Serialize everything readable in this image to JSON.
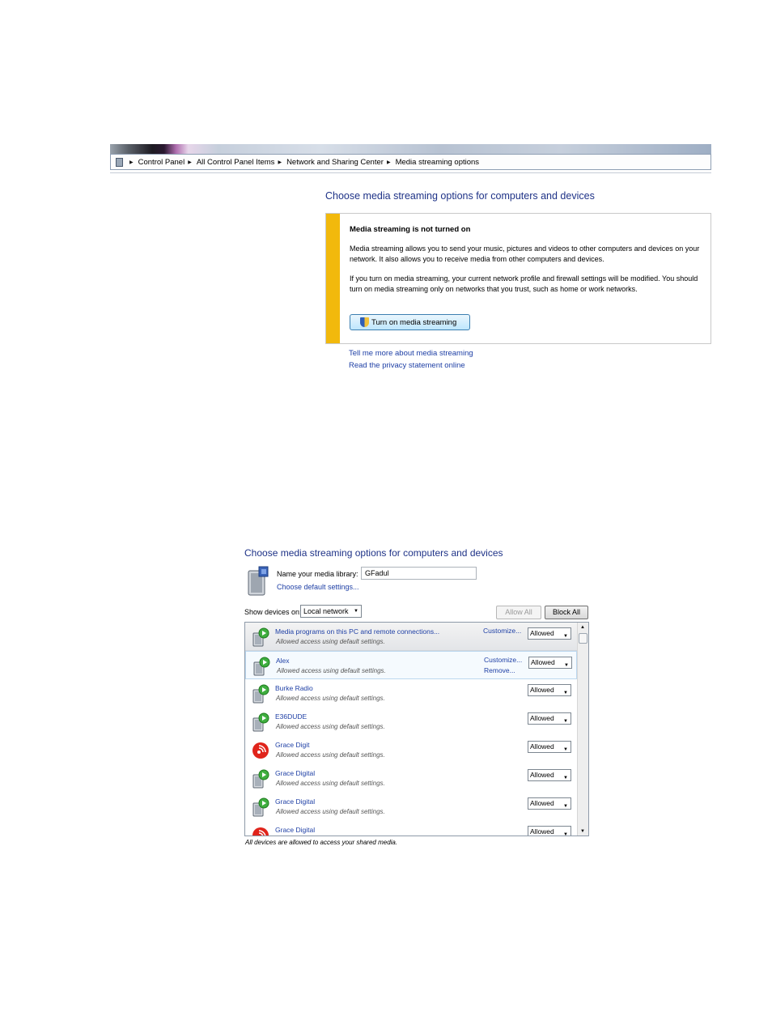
{
  "breadcrumb": {
    "items": [
      "Control Panel",
      "All Control Panel Items",
      "Network and Sharing Center",
      "Media streaming options"
    ]
  },
  "top_panel": {
    "heading": "Choose media streaming options for computers and devices",
    "info_title": "Media streaming is not turned on",
    "info_p1": "Media streaming allows you to send your music, pictures and videos to other computers and devices on your network.  It also allows you to receive media from other computers and devices.",
    "info_p2": "If you turn on media streaming, your current network profile and firewall settings will be modified. You should turn on media streaming only on networks that you trust, such as home or work networks.",
    "turn_on_label": "Turn on media streaming",
    "link_tell_more": "Tell me more about media streaming",
    "link_privacy": "Read the privacy statement online",
    "accent_color": "#f2b90c"
  },
  "bottom_panel": {
    "heading": "Choose media streaming options for computers and devices",
    "library_label": "Name your media library:",
    "library_value": "GFadul",
    "choose_defaults_link": "Choose default settings...",
    "show_devices_label": "Show devices on:",
    "network_option": "Local network",
    "allow_all_label": "Allow All",
    "block_all_label": "Block All",
    "devices": [
      {
        "name": "Media programs on this PC and remote connections...",
        "status": "Allowed access using default settings.",
        "access": "Allowed",
        "icon": "media-device-icon",
        "link1": "Customize...",
        "link2": ""
      },
      {
        "name": "Alex",
        "status": "Allowed access using default settings.",
        "access": "Allowed",
        "icon": "media-device-icon",
        "link1": "Customize...",
        "link2": "Remove..."
      },
      {
        "name": "Burke Radio",
        "status": "Allowed access using default settings.",
        "access": "Allowed",
        "icon": "media-device-icon",
        "link1": "",
        "link2": ""
      },
      {
        "name": "E36DUDE",
        "status": "Allowed access using default settings.",
        "access": "Allowed",
        "icon": "media-device-icon",
        "link1": "",
        "link2": ""
      },
      {
        "name": "Grace Digit",
        "status": "Allowed access using default settings.",
        "access": "Allowed",
        "icon": "grace-radio-icon",
        "link1": "",
        "link2": ""
      },
      {
        "name": "Grace Digital",
        "status": "Allowed access using default settings.",
        "access": "Allowed",
        "icon": "media-device-icon",
        "link1": "",
        "link2": ""
      },
      {
        "name": "Grace Digital",
        "status": "Allowed access using default settings.",
        "access": "Allowed",
        "icon": "media-device-icon",
        "link1": "",
        "link2": ""
      },
      {
        "name": "Grace Digital",
        "status": "",
        "access": "Allowed",
        "icon": "grace-radio-icon",
        "link1": "",
        "link2": ""
      }
    ],
    "footer_note": "All devices are allowed to access your shared media."
  }
}
